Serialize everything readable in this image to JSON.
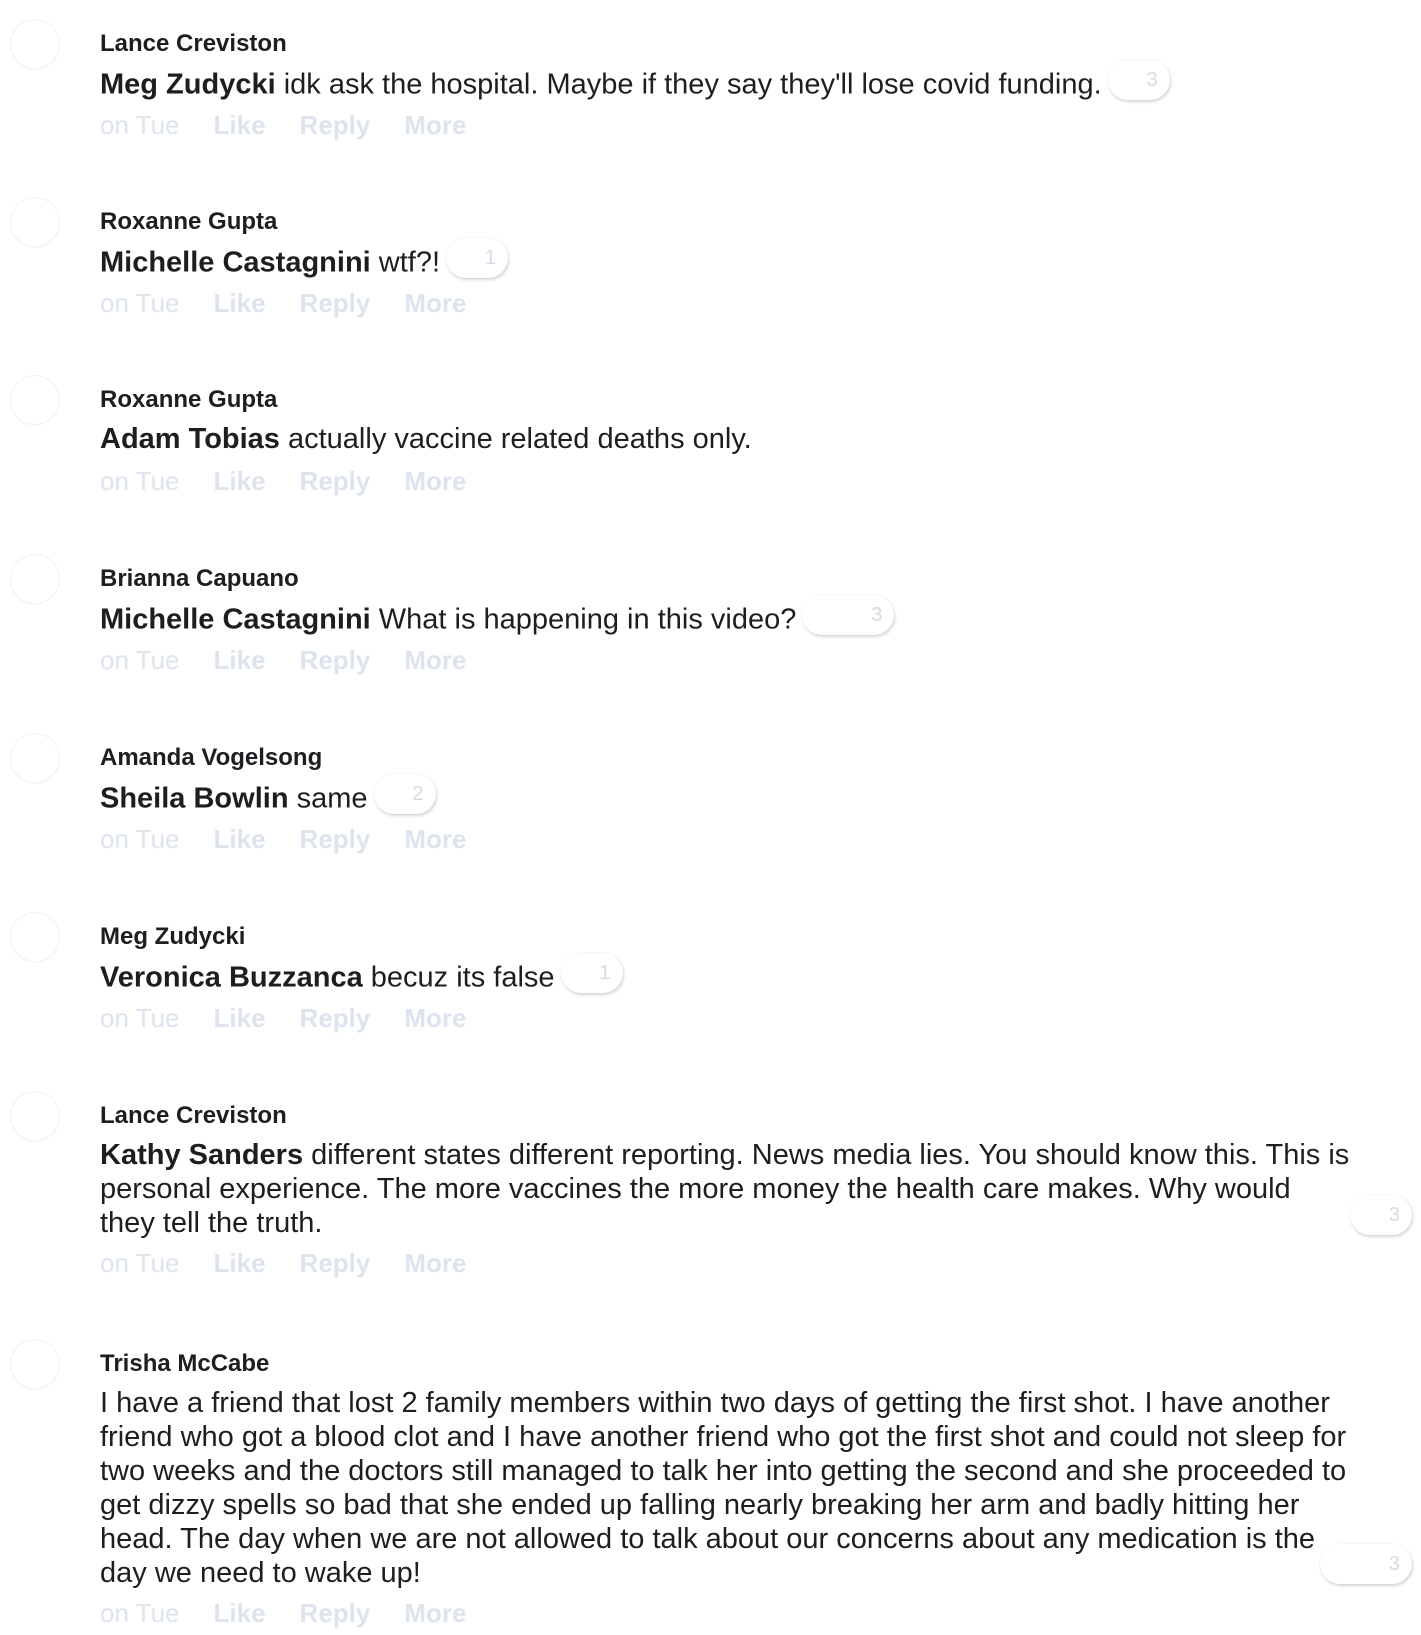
{
  "comments": [
    {
      "author": "Lance Creviston",
      "mention": "Meg Zudycki",
      "text": " idk ask the hospital. Maybe if they say they'll lose covid funding.",
      "reaction_count": "3",
      "time": "on Tue"
    },
    {
      "author": "Roxanne Gupta",
      "mention": "Michelle Castagnini",
      "text": " wtf?!",
      "reaction_count": "1",
      "time": "on Tue"
    },
    {
      "author": "Roxanne Gupta",
      "mention": "Adam Tobias",
      "text": " actually vaccine related deaths only.",
      "reaction_count": "",
      "time": "on Tue"
    },
    {
      "author": "Brianna Capuano",
      "mention": "Michelle Castagnini",
      "text": " What is happening in this video?",
      "reaction_count": "3",
      "time": "on Tue"
    },
    {
      "author": "Amanda Vogelsong",
      "mention": "Sheila Bowlin",
      "text": " same",
      "reaction_count": "2",
      "time": "on Tue"
    },
    {
      "author": "Meg Zudycki",
      "mention": "Veronica Buzzanca",
      "text": " becuz its false",
      "reaction_count": "1",
      "time": "on Tue"
    },
    {
      "author": "Lance Creviston",
      "mention": "Kathy Sanders",
      "text": " different states different reporting. News media lies. You should know this. This is personal experience. The more vaccines the more money the health care makes. Why would they tell the truth.",
      "reaction_count": "3",
      "time": "on Tue"
    },
    {
      "author": "Trisha McCabe",
      "mention": "",
      "text": "I have a friend that lost 2 family members within two days of getting the first shot. I have another friend who got a blood clot and I have another friend who got the first shot and could not sleep for two weeks and the doctors still managed to talk her into getting the second and she proceeded to get dizzy spells so bad that she ended up falling nearly breaking her arm and badly hitting her head. The day when we are not allowed to talk about our concerns about any medication is the day we need to wake up!",
      "reaction_count": "3",
      "time": "on Tue"
    }
  ],
  "actions": {
    "like": "Like",
    "reply": "Reply",
    "more": "More"
  }
}
